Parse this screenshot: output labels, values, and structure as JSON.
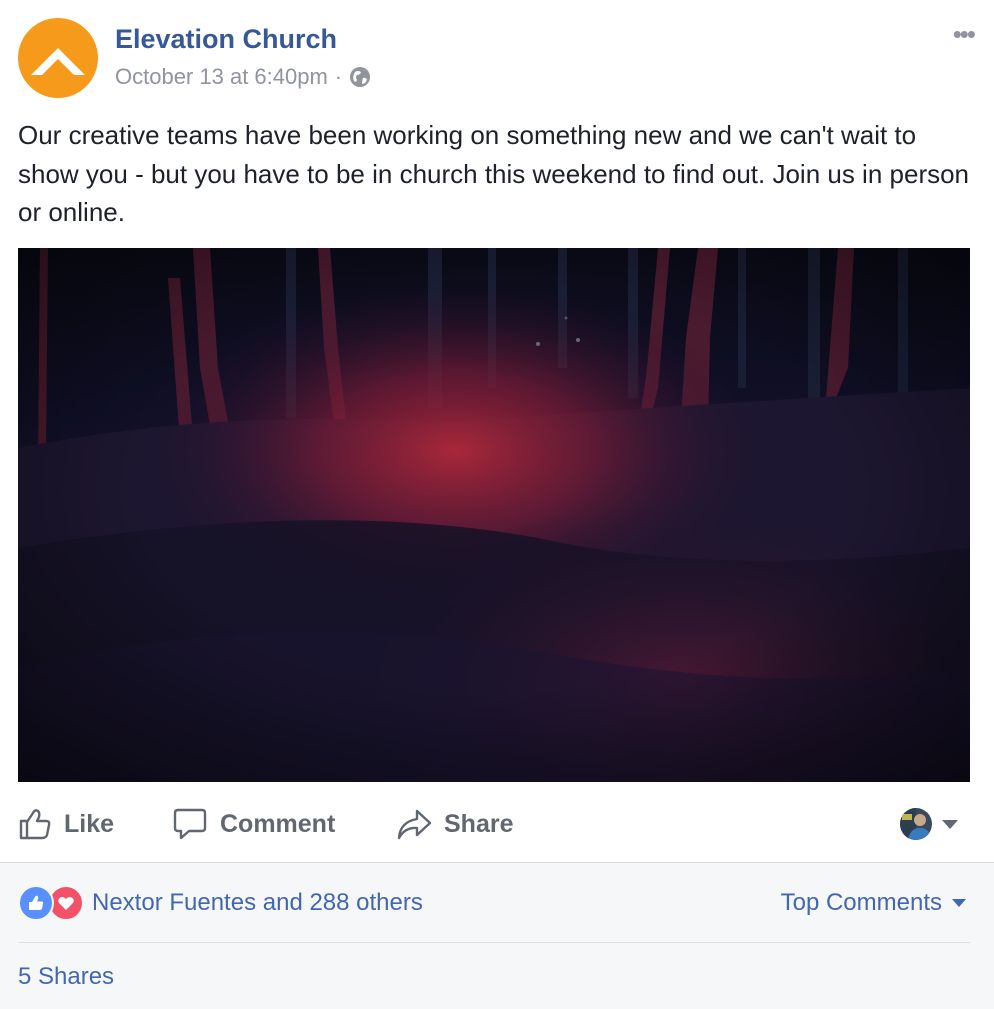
{
  "post": {
    "page_name": "Elevation Church",
    "timestamp": "October 13 at 6:40pm",
    "separator": "·",
    "audience_icon": "globe-icon",
    "more_icon": "more-options-icon",
    "more_glyph": "•••",
    "text": "Our creative teams have been working on something new and we can't wait to show you - but you have to be in church this weekend to find out. Join us in person or online.",
    "avatar_color": "#f59a1a",
    "name_color": "#365899"
  },
  "actions": {
    "like_label": "Like",
    "comment_label": "Comment",
    "share_label": "Share"
  },
  "footer": {
    "reactions_text": "Nextor Fuentes and 288 others",
    "reaction_types": [
      "like",
      "love"
    ],
    "sort_label": "Top Comments",
    "shares_text": "5 Shares",
    "link_color": "#4267b2"
  }
}
